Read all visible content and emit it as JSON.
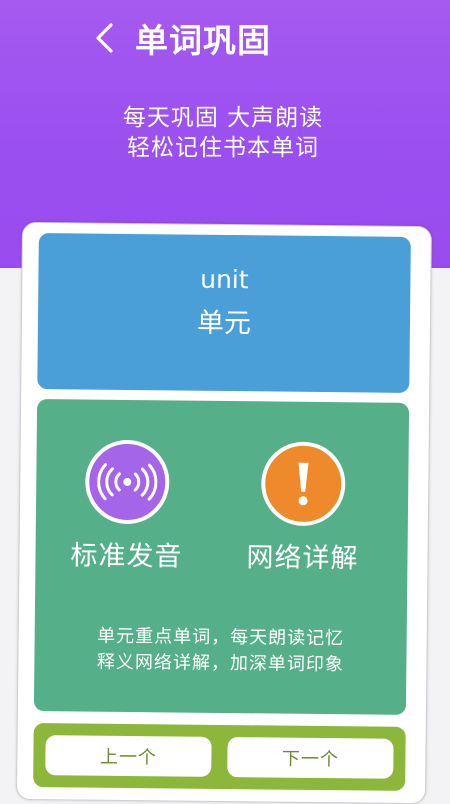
{
  "header": {
    "title": "单词巩固",
    "back_icon": "chevron-left-icon",
    "subtitle_line1": "每天巩固 大声朗读",
    "subtitle_line2": "轻松记住书本单词"
  },
  "word": {
    "english": "unit",
    "chinese": "单元"
  },
  "actions": {
    "pronunciation_label": "标准发音",
    "pronunciation_icon": "sound-wave-icon",
    "details_label": "网络详解",
    "details_icon": "exclamation-icon"
  },
  "description": {
    "line1": "单元重点单词，每天朗读记忆",
    "line2": "释义网络详解，加深单词印象"
  },
  "navigation": {
    "prev_label": "上一个",
    "next_label": "下一个"
  },
  "colors": {
    "header": "#9a4ff0",
    "word_panel": "#4a9fd8",
    "green_panel": "#55b08a",
    "nav_bar": "#8db73a",
    "pronunciation_circle": "#a565e8",
    "details_circle": "#ef8a2c"
  }
}
